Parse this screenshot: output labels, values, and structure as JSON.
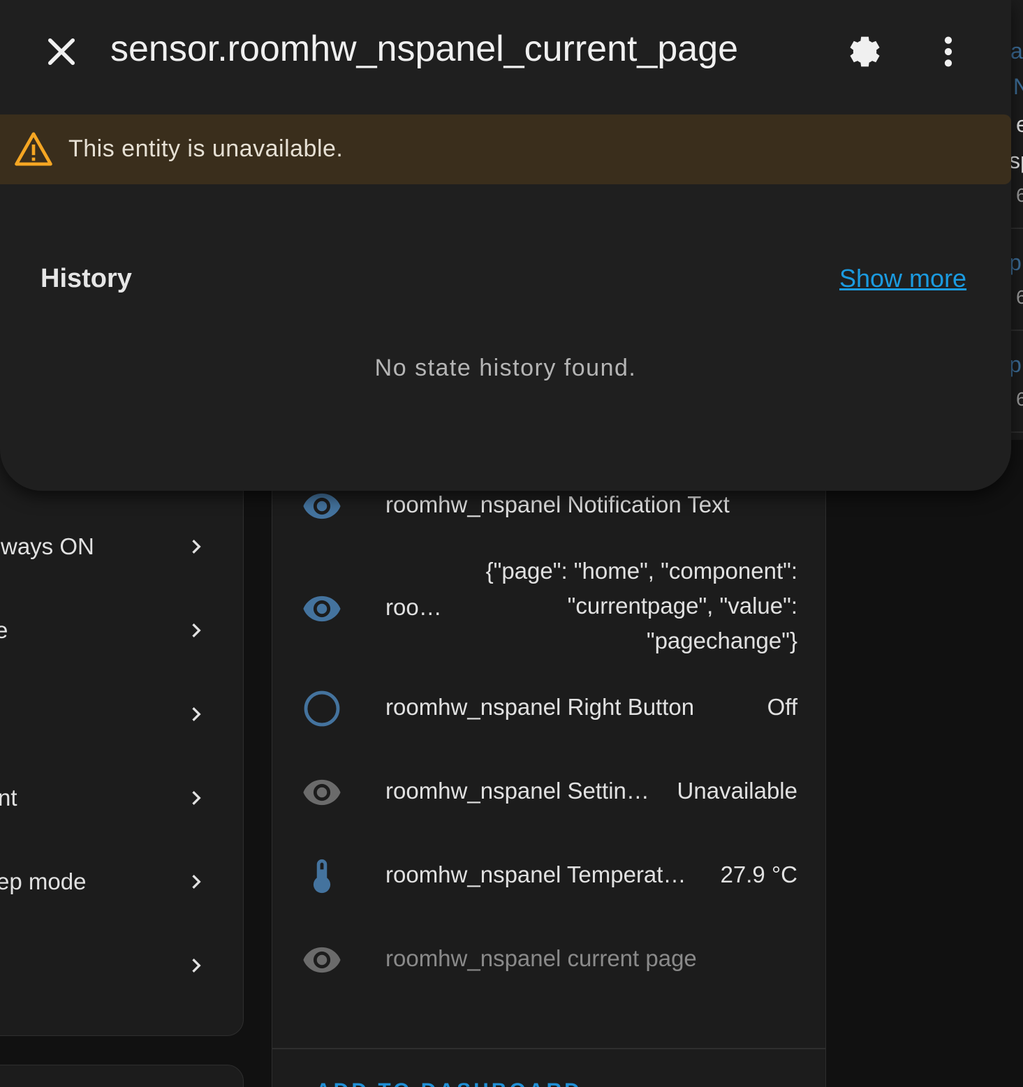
{
  "dialog": {
    "title": "sensor.roomhw_nspanel_current_page",
    "warning": "This entity is unavailable.",
    "history_title": "History",
    "show_more": "Show more",
    "no_history": "No state history found."
  },
  "left_settings": {
    "items": [
      {
        "label": "ways ON"
      },
      {
        "label": "e"
      },
      {
        "label": ""
      },
      {
        "label": "nt"
      },
      {
        "label": "ep mode"
      },
      {
        "label": ""
      }
    ]
  },
  "entities": {
    "items": [
      {
        "icon": "eye-icon",
        "name": "roomhw_nspanel Notification Text",
        "state": ""
      },
      {
        "icon": "eye-icon",
        "name": "roo…",
        "state_lines": [
          "{\"page\": \"home\", \"component\":",
          "\"currentpage\", \"value\":",
          "\"pagechange\"}"
        ]
      },
      {
        "icon": "circle-outline-icon",
        "name": "roomhw_nspanel Right Button",
        "state": "Off"
      },
      {
        "icon": "eye-icon",
        "name": "roomhw_nspanel Settin…",
        "state": "Unavailable"
      },
      {
        "icon": "thermometer-icon",
        "name": "roomhw_nspanel Temperat…",
        "state": "27.9 °C"
      },
      {
        "icon": "eye-icon",
        "name": "roomhw_nspanel current page",
        "state": ""
      }
    ],
    "add_to_dashboard": "ADD TO DASHBOARD"
  },
  "right_fragments": [
    "a",
    "N",
    "e",
    "sp",
    "6",
    "p",
    "6",
    "p",
    "6"
  ],
  "colors": {
    "accent": "#1b9be0",
    "warning_icon": "#f5a623",
    "warning_bg": "#3a2e1c",
    "entity_icon_blue": "#44739e"
  }
}
